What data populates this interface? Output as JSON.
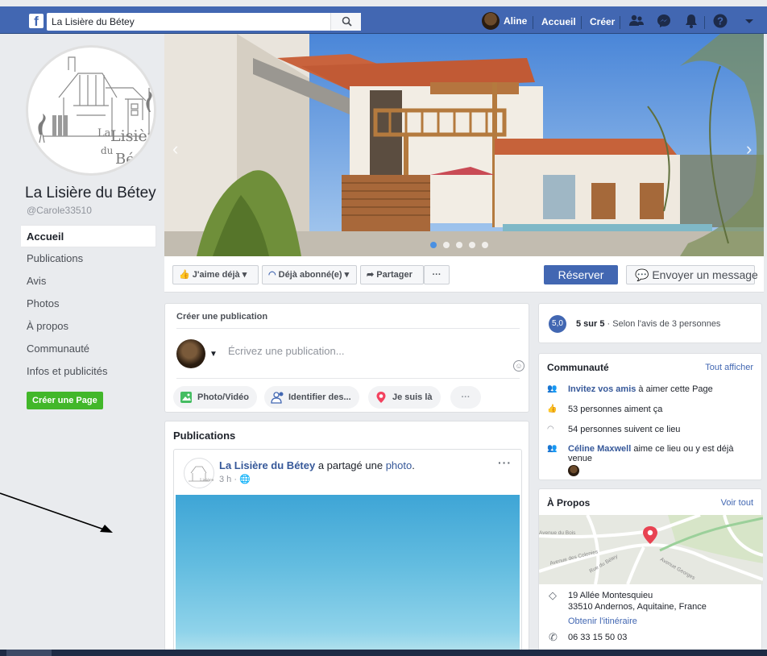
{
  "topbar": {
    "logo": "f",
    "search_value": "La Lisière du Bétey",
    "user_name": "Aline",
    "home_label": "Accueil",
    "create_label": "Créer"
  },
  "page": {
    "name": "La Lisière du Bétey",
    "handle": "@Carole33510",
    "logo_line1": "La",
    "logo_line2": "Lisière",
    "logo_line3": "du",
    "logo_line4": "Bétey"
  },
  "left_nav": {
    "items": [
      "Accueil",
      "Publications",
      "Avis",
      "Photos",
      "À propos",
      "Communauté",
      "Infos et publicités"
    ],
    "create_page": "Créer une Page"
  },
  "cover": {
    "slide_count": 5,
    "active_slide": 1
  },
  "actions": {
    "like": "J'aime déjà",
    "follow": "Déjà abonné(e)",
    "share": "Partager",
    "more": "···",
    "reserve": "Réserver",
    "message": "Envoyer un message"
  },
  "composer": {
    "title": "Créer une publication",
    "placeholder": "Écrivez une publication...",
    "photo": "Photo/Vidéo",
    "tag": "Identifier des...",
    "checkin": "Je suis là",
    "more": "···"
  },
  "publications": {
    "title": "Publications",
    "post": {
      "author": "La Lisière du Bétey",
      "action": " a partagé une ",
      "object": "photo",
      "dot": ".",
      "time": "3 h · ",
      "more": "···"
    }
  },
  "rating": {
    "score": "5,0",
    "text_bold": "5 sur 5",
    "text_rest": " · Selon l'avis de 3 personnes"
  },
  "community": {
    "title": "Communauté",
    "see_all": "Tout afficher",
    "invite_link": "Invitez vos amis",
    "invite_rest": " à aimer cette Page",
    "likes": "53 personnes aiment ça",
    "follows": "54 personnes suivent ce lieu",
    "friend_name": "Céline Maxwell",
    "friend_rest": " aime ce lieu ou y est déjà venue"
  },
  "about": {
    "title": "À Propos",
    "see_all": "Voir tout",
    "map_labels": [
      "Avenue du Bois",
      "Avenue des Colonies",
      "Rue du Bétey",
      "Avenue Georges"
    ],
    "address1": "19 Allée Montesquieu",
    "address2": "33510 Andernos, Aquitaine, France",
    "directions": "Obtenir l'itinéraire",
    "phone": "06 33 15 50 03"
  },
  "colors": {
    "fb_blue": "#4267b2",
    "green": "#42b72a",
    "pin": "#e84352"
  }
}
